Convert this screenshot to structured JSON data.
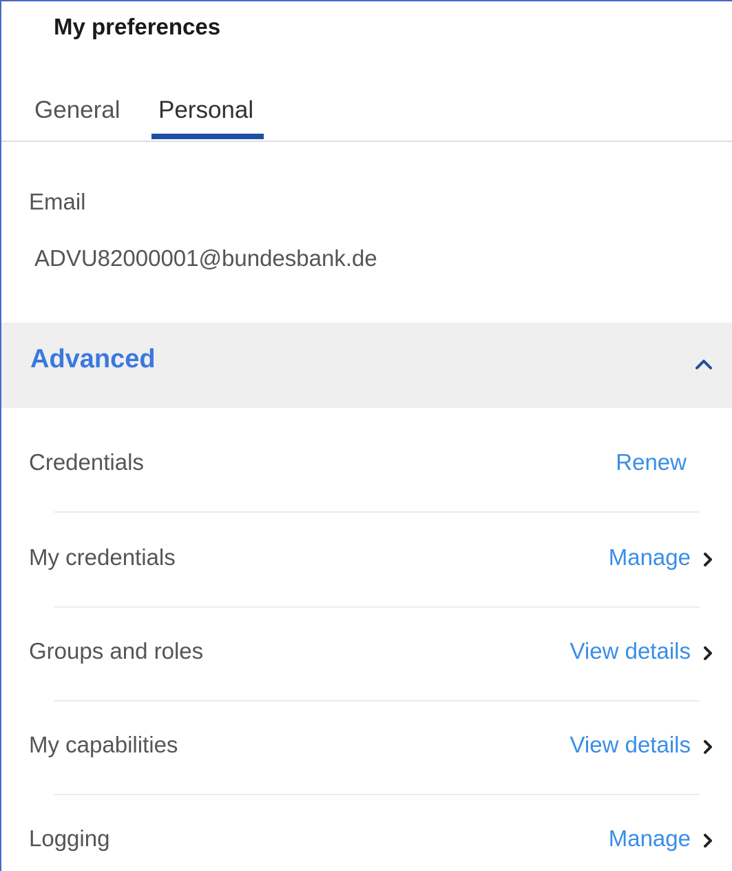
{
  "header": {
    "title": "My preferences"
  },
  "tabs": [
    {
      "label": "General",
      "selected": false
    },
    {
      "label": "Personal",
      "selected": true
    }
  ],
  "email": {
    "label": "Email",
    "value": "ADVU82000001@bundesbank.de"
  },
  "advanced": {
    "title": "Advanced",
    "expanded": true,
    "toggle_icon": "chevron-up-icon",
    "rows": [
      {
        "label": "Credentials",
        "action": "Renew",
        "chevron": false
      },
      {
        "label": "My credentials",
        "action": "Manage",
        "chevron": true
      },
      {
        "label": "Groups and roles",
        "action": "View details",
        "chevron": true
      },
      {
        "label": "My capabilities",
        "action": "View details",
        "chevron": true
      },
      {
        "label": "Logging",
        "action": "Manage",
        "chevron": true
      }
    ]
  },
  "colors": {
    "accent_tab": "#1f4fa3",
    "link": "#3a8ee6",
    "section_title": "#3a78e0",
    "section_bg": "#efefef"
  }
}
